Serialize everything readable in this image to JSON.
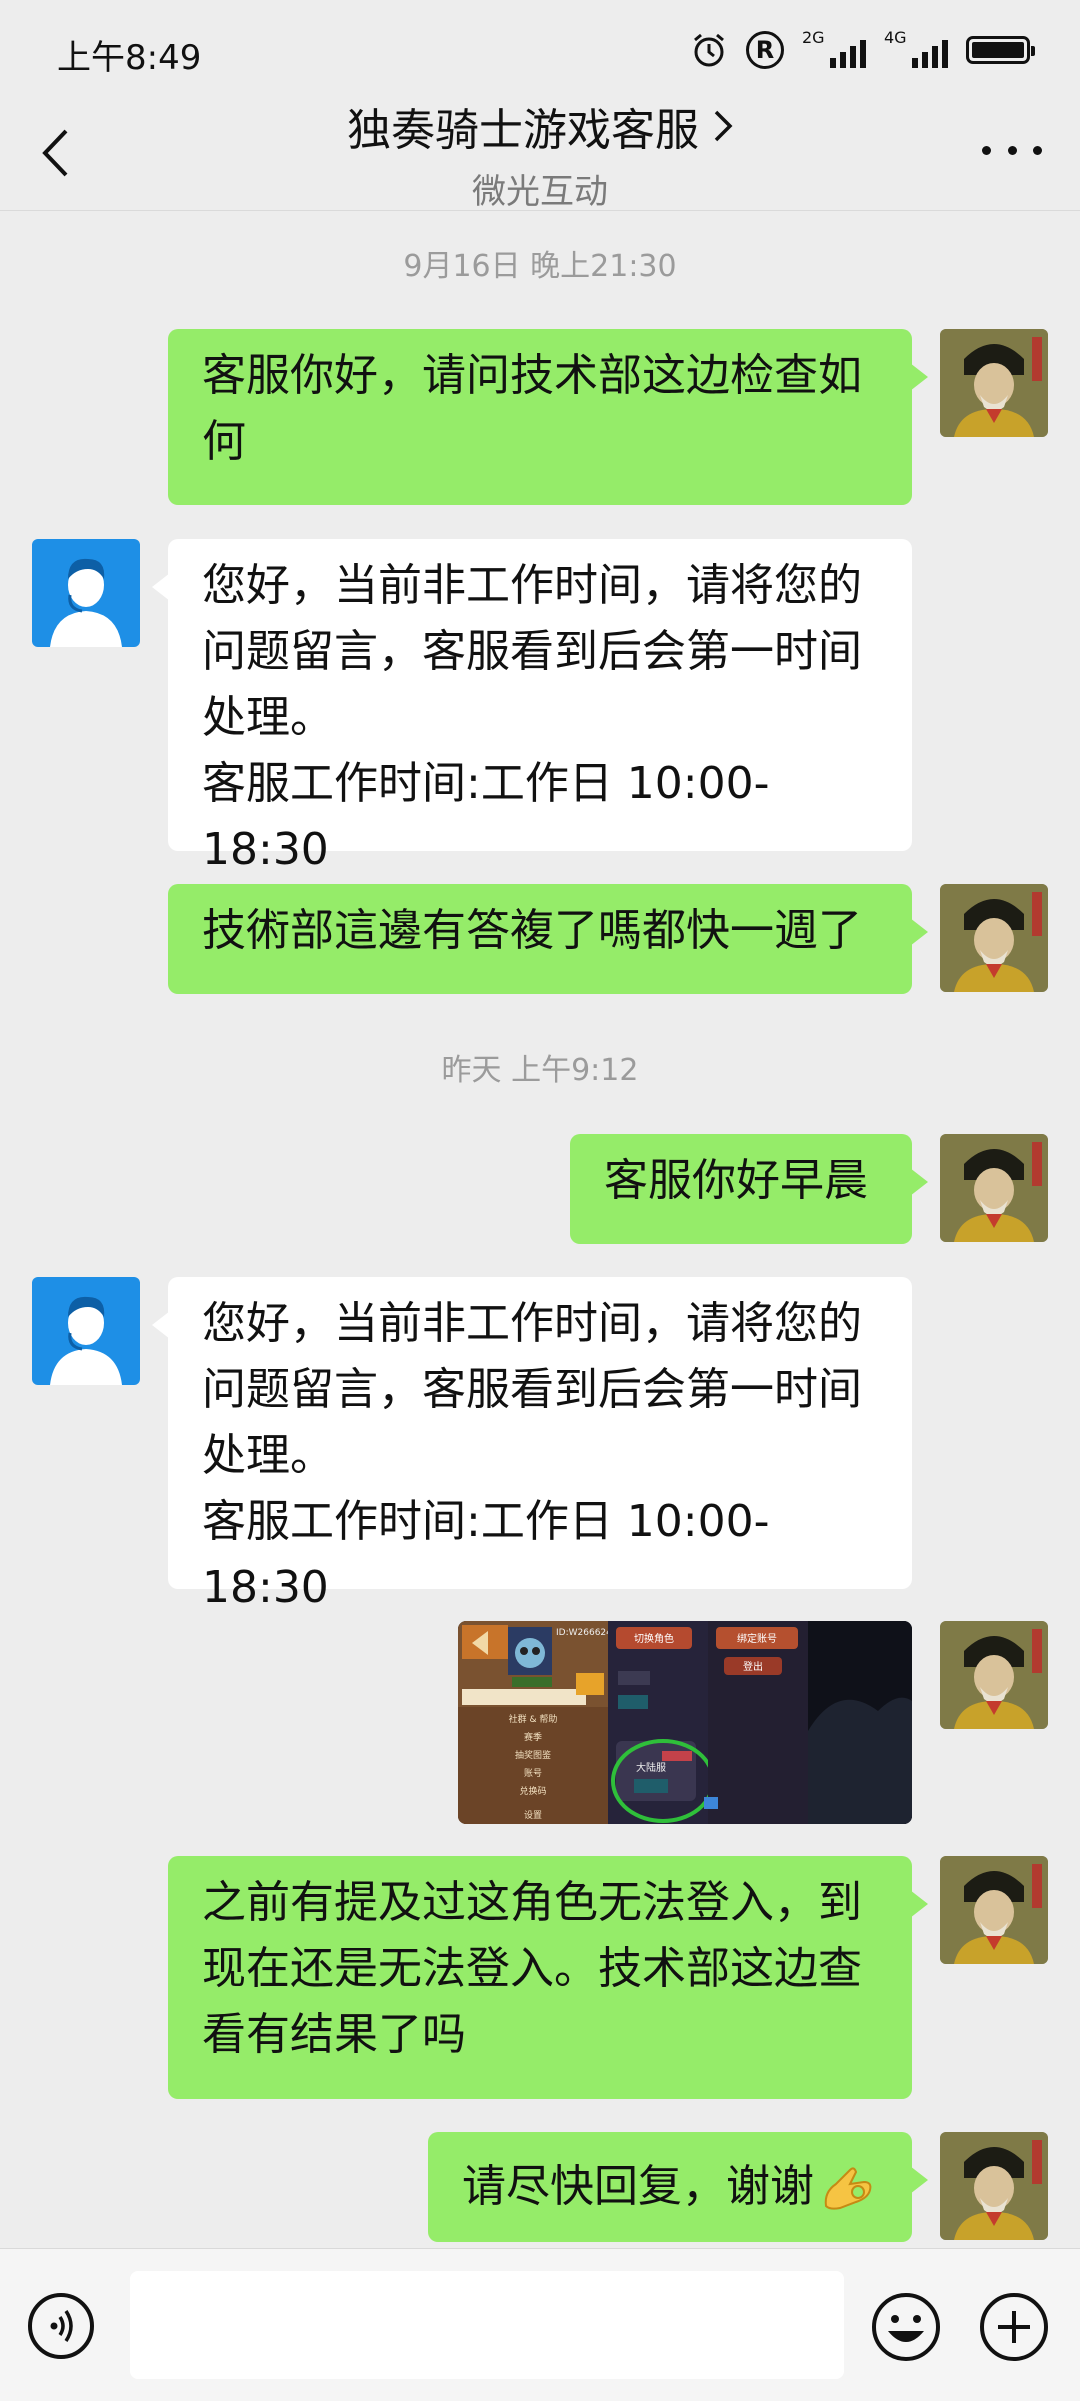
{
  "status_bar": {
    "time": "上午8:49",
    "r_symbol": "R",
    "sim1_label": "2G",
    "sim2_label": "4G"
  },
  "header": {
    "title": "独奏骑士游戏客服",
    "subtitle": "微光互动",
    "icons": [
      "back-chevron-icon",
      "title-chevron-right-icon",
      "more-dots-icon"
    ]
  },
  "messages": {
    "ts1": "9月16日 晚上21:30",
    "m1": [
      "客服你好，请问技术部这边检查如",
      "何"
    ],
    "m2": [
      "您好，当前非工作时间，请将您的",
      "问题留言，客服看到后会第一时间",
      "处理。",
      "客服工作时间:工作日 10:00-18:30"
    ],
    "m3": [
      "技術部這邊有答複了嗎都快一週了"
    ],
    "ts2": "昨天 上午9:12",
    "m4": [
      "客服你好早晨"
    ],
    "m5": [
      "您好，当前非工作时间，请将您的",
      "问题留言，客服看到后会第一时间",
      "处理。",
      "客服工作时间:工作日 10:00-18:30"
    ],
    "m6": [
      "之前有提及过这角色无法登入，到",
      "现在还是无法登入。技术部这边查",
      "看有结果了吗"
    ],
    "m7": [
      "请尽快回复，谢谢"
    ]
  },
  "screenshot_image": {
    "labels": {
      "id": "ID:W2666242",
      "switch_role": "切换角色",
      "bind_account": "绑定账号",
      "logout": "登出",
      "menu1": "社群 & 帮助",
      "menu2": "赛季",
      "menu3": "抽奖图鉴",
      "menu4": "账号",
      "menu5": "兑换码",
      "menu6": "设置",
      "server": "大陆服"
    }
  },
  "input_bar": {
    "icons": [
      "voice-icon",
      "emoji-icon",
      "plus-icon"
    ]
  },
  "colors": {
    "background": "#ededed",
    "my_bubble": "#95ec69",
    "other_bubble": "#ffffff",
    "support_avatar": "#1e8fe6"
  }
}
